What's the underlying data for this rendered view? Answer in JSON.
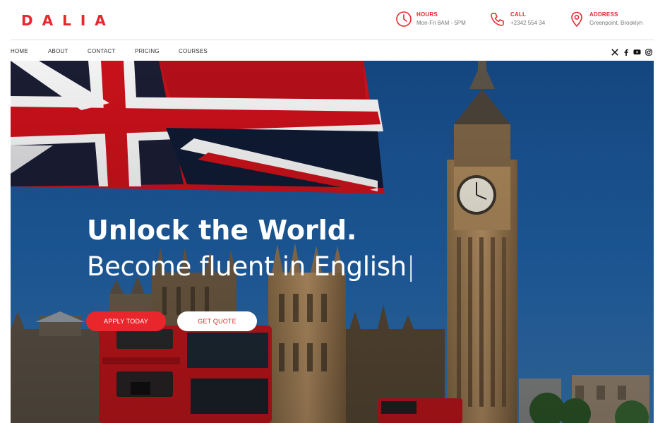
{
  "brand": {
    "logo": "DALIA",
    "accent": "#e8262c"
  },
  "header": {
    "hours": {
      "label": "HOURS",
      "value": "Mon-Fri 8AM - 5PM",
      "icon": "clock-icon"
    },
    "call": {
      "label": "CALL",
      "value": "+2342 554 34",
      "icon": "phone-icon"
    },
    "address": {
      "label": "ADDRESS",
      "value": "Greenpoint, Brooklyn",
      "icon": "map-pin-icon"
    }
  },
  "nav": {
    "items": [
      {
        "label": "HOME"
      },
      {
        "label": "ABOUT"
      },
      {
        "label": "CONTACT"
      },
      {
        "label": "PRICING"
      },
      {
        "label": "COURSES"
      }
    ]
  },
  "social": [
    "x-icon",
    "facebook-icon",
    "youtube-icon",
    "instagram-icon"
  ],
  "hero": {
    "title": "Unlock the World.",
    "subtitle": "Become fluent in English",
    "cursor": "|",
    "primary_button": "APPLY TODAY",
    "secondary_button": "GET QUOTE"
  }
}
